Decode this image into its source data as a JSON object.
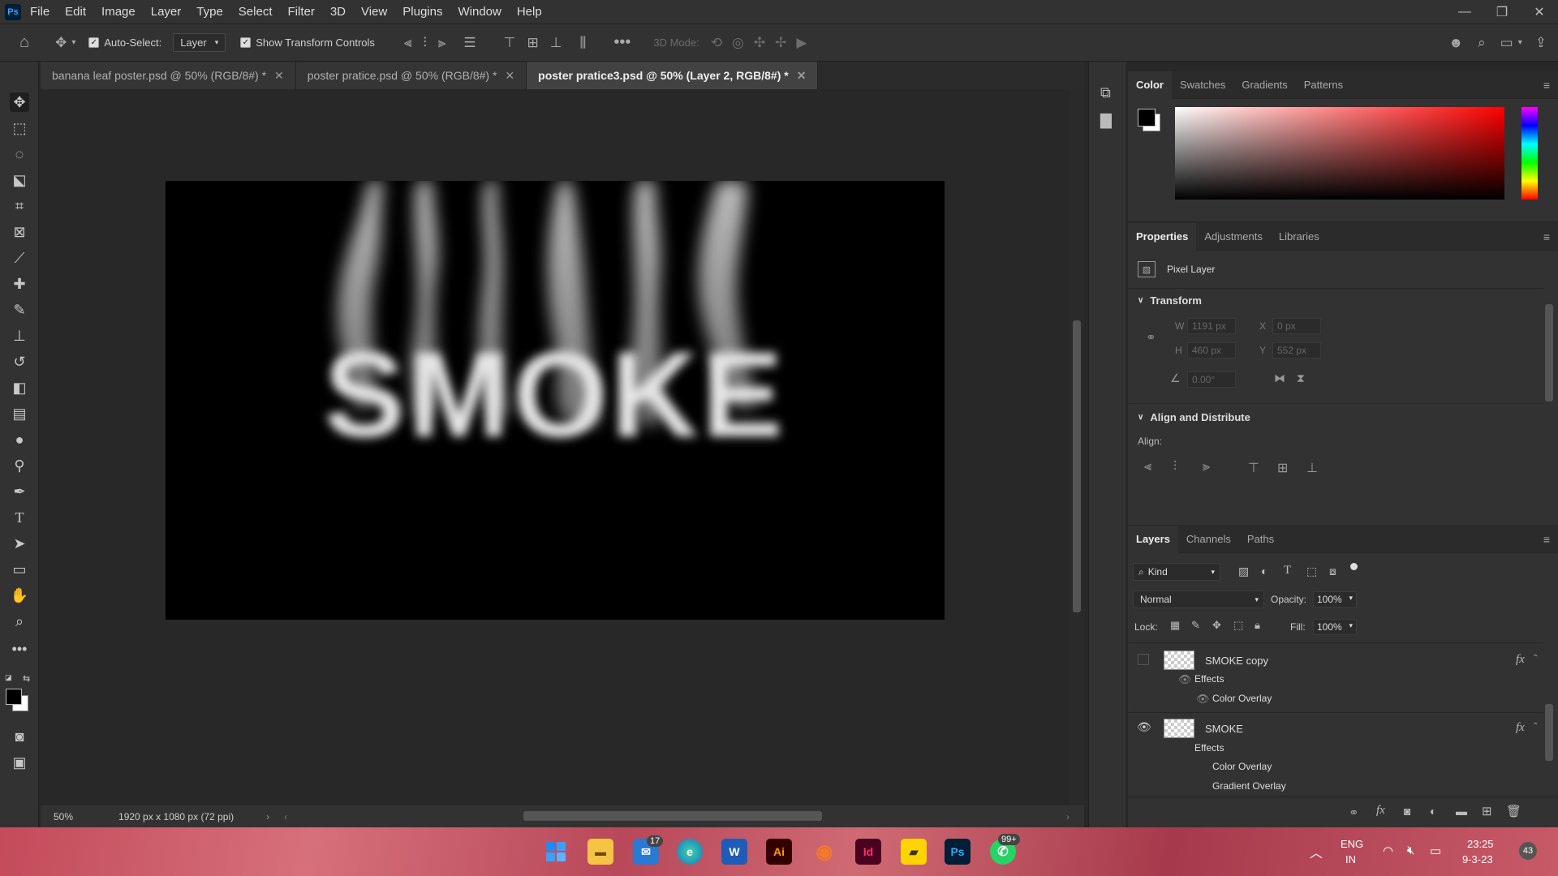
{
  "app": {
    "logo": "Ps"
  },
  "menu": [
    "File",
    "Edit",
    "Image",
    "Layer",
    "Type",
    "Select",
    "Filter",
    "3D",
    "View",
    "Plugins",
    "Window",
    "Help"
  ],
  "options": {
    "auto_select_label": "Auto-Select:",
    "auto_select_value": "Layer",
    "show_transform_label": "Show Transform Controls",
    "mode_label": "3D Mode:"
  },
  "tabs": [
    {
      "label": "banana leaf poster.psd @ 50% (RGB/8#) *"
    },
    {
      "label": "poster pratice.psd @ 50% (RGB/8#) *"
    },
    {
      "label": "poster pratice3.psd @ 50% (Layer 2, RGB/8#) *"
    }
  ],
  "canvas": {
    "smoke_text": "SMOKE"
  },
  "status": {
    "zoom": "50%",
    "doc_info": "1920 px x 1080 px (72 ppi)"
  },
  "color_panel": {
    "tabs": [
      "Color",
      "Swatches",
      "Gradients",
      "Patterns"
    ]
  },
  "props_panel": {
    "tabs": [
      "Properties",
      "Adjustments",
      "Libraries"
    ],
    "layer_type": "Pixel Layer",
    "transform_title": "Transform",
    "w_label": "W",
    "w_value": "1191 px",
    "h_label": "H",
    "h_value": "460 px",
    "x_label": "X",
    "x_value": "0 px",
    "y_label": "Y",
    "y_value": "552 px",
    "angle_value": "0.00°",
    "align_title": "Align and Distribute",
    "align_label": "Align:"
  },
  "layers_panel": {
    "tabs": [
      "Layers",
      "Channels",
      "Paths"
    ],
    "filter_label": "Kind",
    "blend_mode": "Normal",
    "opacity_label": "Opacity:",
    "opacity_value": "100%",
    "lock_label": "Lock:",
    "fill_label": "Fill:",
    "fill_value": "100%",
    "layers": [
      {
        "name": "SMOKE copy",
        "effects_label": "Effects",
        "effects": [
          "Color Overlay"
        ]
      },
      {
        "name": "SMOKE",
        "effects_label": "Effects",
        "effects": [
          "Color Overlay",
          "Gradient Overlay"
        ]
      }
    ]
  },
  "taskbar": {
    "mail_badge": "17",
    "whatsapp_badge": "99+",
    "lang": "ENG",
    "region": "IN",
    "time": "23:25",
    "date": "9-3-23",
    "notif_count": "43"
  },
  "colors": {
    "accent": "#31a8ff",
    "canvas_bg": "#000000",
    "ui_bg": "#323232"
  }
}
